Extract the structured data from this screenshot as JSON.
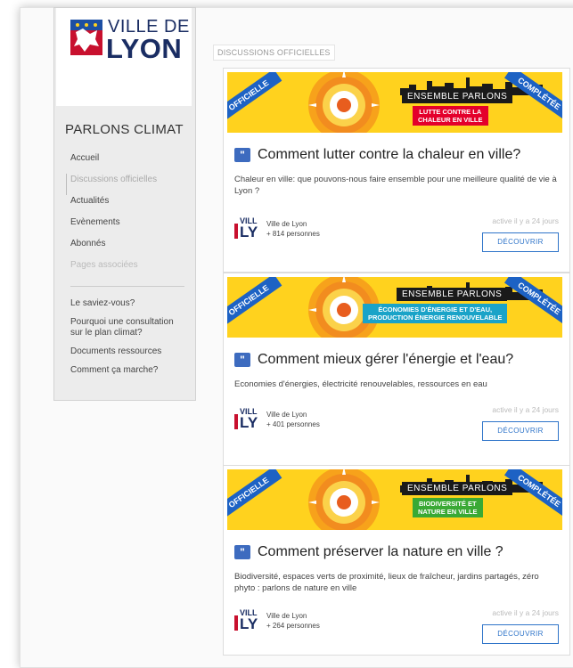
{
  "logo": {
    "ville": "VILLE DE",
    "lyon": "LYON"
  },
  "sidebar": {
    "title": "PARLONS CLIMAT",
    "menu": [
      "Accueil",
      "Discussions officielles",
      "Actualités",
      "Evènements",
      "Abonnés",
      "Pages associées"
    ],
    "menu2": [
      "Le saviez-vous?",
      "Pourquoi une consultation sur le plan climat?",
      "Documents ressources",
      "Comment ça marche?"
    ]
  },
  "section_label": "DISCUSSIONS OFFICIELLES",
  "cards": [
    {
      "ribbon_left": "OFFICIELLE",
      "ribbon_right": "COMPLÉTÉE",
      "ensemble": "ENSEMBLE PARLONS",
      "topic": "LUTTE CONTRE LA\nCHALEUR EN VILLE",
      "topic_color": "#e4002b",
      "title": "Comment lutter contre la chaleur en ville?",
      "desc": "Chaleur en ville: que pouvons-nous faire ensemble pour une meilleure qualité de vie à Lyon ?",
      "author_name": "Ville de Lyon",
      "author_count": "+ 814 personnes",
      "activity": "active il y a 24 jours",
      "button": "DÉCOUVRIR"
    },
    {
      "ribbon_left": "OFFICIELLE",
      "ribbon_right": "COMPLÉTÉE",
      "ensemble": "ENSEMBLE PARLONS",
      "topic": "ÉCONOMIES D'ÉNERGIE ET D'EAU,\nPRODUCTION ÉNERGIE RENOUVELABLE",
      "topic_color": "#1aa3c8",
      "title": "Comment mieux gérer l'énergie et l'eau?",
      "desc": "Economies d'énergies, électricité renouvelables, ressources en eau",
      "author_name": "Ville de Lyon",
      "author_count": "+ 401 personnes",
      "activity": "active il y a 24 jours",
      "button": "DÉCOUVRIR"
    },
    {
      "ribbon_left": "OFFICIELLE",
      "ribbon_right": "COMPLÉTÉE",
      "ensemble": "ENSEMBLE PARLONS",
      "topic": "BIODIVERSITÉ ET\nNATURE EN VILLE",
      "topic_color": "#3aa935",
      "title": "Comment préserver la nature en ville ?",
      "desc": "Biodiversité, espaces verts de proximité, lieux de fraîcheur, jardins partagés, zéro phyto : parlons de nature en ville",
      "author_name": "Ville de Lyon",
      "author_count": "+ 264 personnes",
      "activity": "active il y a 24 jours",
      "button": "DÉCOUVRIR"
    }
  ],
  "author_logo": {
    "vill": "VILL",
    "ly": "LY"
  },
  "colors": {
    "brand_blue": "#1a2d63",
    "accent_blue": "#2e74c9",
    "banner_yellow": "#ffd21e"
  }
}
